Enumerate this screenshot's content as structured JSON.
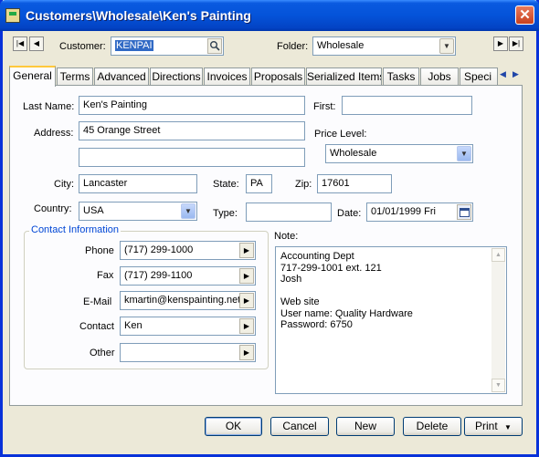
{
  "window": {
    "title": "Customers\\Wholesale\\Ken's Painting",
    "close_glyph": "✕"
  },
  "header": {
    "customer_label": "Customer:",
    "customer_value": "KENPAI",
    "folder_label": "Folder:",
    "folder_value": "Wholesale",
    "nav_first": "|◀",
    "nav_prev": "◀",
    "nav_next": "▶",
    "nav_last": "▶|"
  },
  "tabs": [
    "General",
    "Terms",
    "Advanced",
    "Directions",
    "Invoices",
    "Proposals",
    "Serialized Items",
    "Tasks",
    "Jobs",
    "Speci"
  ],
  "form": {
    "last_name_label": "Last Name:",
    "last_name": "Ken's Painting",
    "first_label": "First:",
    "first": "",
    "address_label": "Address:",
    "address1": "45 Orange Street",
    "address2": "",
    "price_level_label": "Price Level:",
    "price_level": "Wholesale",
    "city_label": "City:",
    "city": "Lancaster",
    "state_label": "State:",
    "state": "PA",
    "zip_label": "Zip:",
    "zip": "17601",
    "country_label": "Country:",
    "country": "USA",
    "type_label": "Type:",
    "type": "",
    "date_label": "Date:",
    "date": "01/01/1999 Fri"
  },
  "contact": {
    "title": "Contact Information",
    "phone_label": "Phone",
    "phone": "(717) 299-1000",
    "fax_label": "Fax",
    "fax": "(717) 299-1100",
    "email_label": "E-Mail",
    "email": "kmartin@kenspainting.net",
    "contact_label": "Contact",
    "contact": "Ken",
    "other_label": "Other",
    "other": ""
  },
  "note": {
    "label": "Note:",
    "lines": [
      "Accounting Dept",
      "717-299-1001 ext. 121",
      "Josh",
      "",
      "Web site",
      "User name: Quality Hardware",
      "Password: 6750"
    ]
  },
  "buttons": {
    "ok": "OK",
    "cancel": "Cancel",
    "new": "New",
    "delete": "Delete",
    "print": "Print"
  },
  "icons": {
    "search": "search-icon",
    "dropdown": "chevron-down-icon",
    "calendar": "calendar-icon",
    "picker": "triangle-right-icon"
  },
  "colors": {
    "title_bar": "#0453d9",
    "group_title": "#0046d5",
    "tab_highlight": "#ffc83c",
    "window_bg": "#ece9d8"
  }
}
